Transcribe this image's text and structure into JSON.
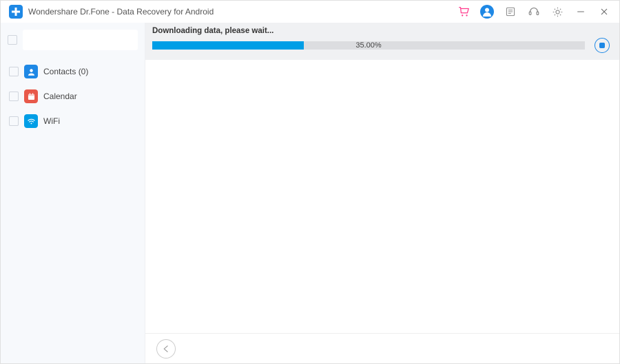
{
  "app": {
    "title": "Wondershare Dr.Fone - Data Recovery for Android"
  },
  "sidebar": {
    "items": [
      {
        "label": "Contacts (0)",
        "icon": "contacts-icon",
        "color": "#1e88e5"
      },
      {
        "label": "Calendar",
        "icon": "calendar-icon",
        "color": "#e8594a"
      },
      {
        "label": "WiFi",
        "icon": "wifi-icon",
        "color": "#009ee6"
      }
    ]
  },
  "progress": {
    "label": "Downloading data, please wait...",
    "percent_label": "35.00%",
    "percent_value": 35
  }
}
